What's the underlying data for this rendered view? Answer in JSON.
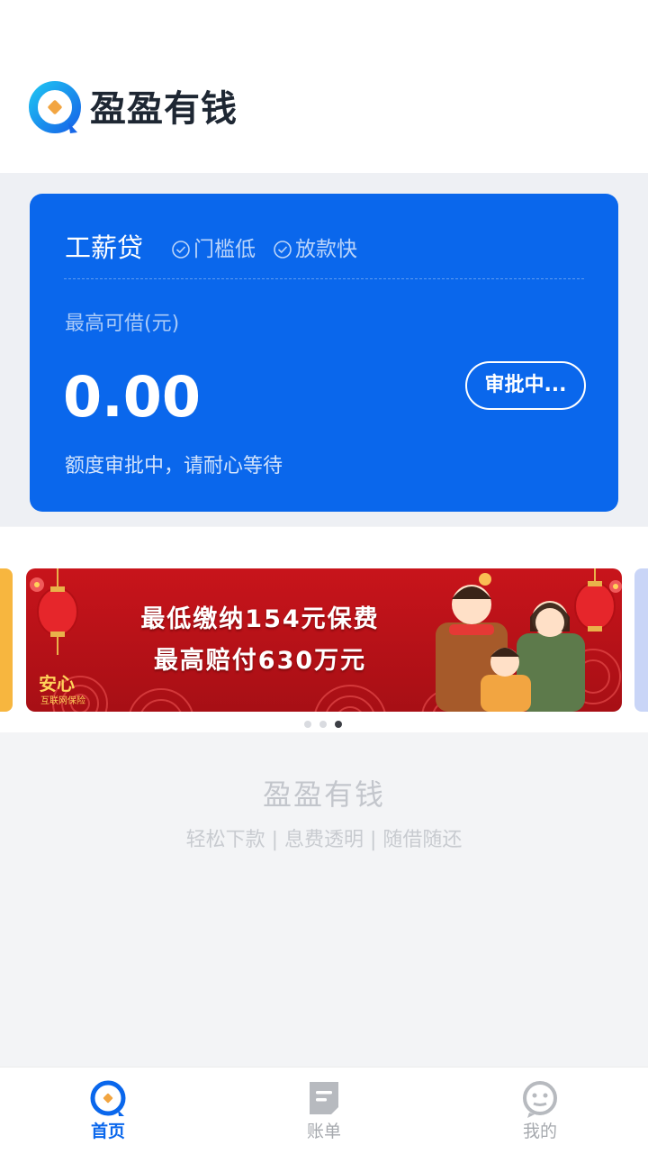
{
  "header": {
    "app_name": "盈盈有钱",
    "logo_icon": "brand-logo-icon"
  },
  "loan_card": {
    "product_name": "工薪贷",
    "tags": [
      "门槛低",
      "放款快"
    ],
    "max_label": "最高可借(元)",
    "amount": "0.00",
    "status_button": "审批中...",
    "hint": "额度审批中，请耐心等待",
    "bg_color": "#0a67ec"
  },
  "banner": {
    "line1": "最低缴纳154元保费",
    "line2": "最高赔付630万元",
    "brand": "安心",
    "brand_sub": "互联网保险",
    "slide_count": 3,
    "active_slide": 3,
    "bg_color": "#c4151c"
  },
  "footer": {
    "brand": "盈盈有钱",
    "slogan": "轻松下款 | 息费透明 | 随借随还"
  },
  "tabbar": {
    "items": [
      {
        "label": "首页",
        "icon": "home-icon",
        "active": true
      },
      {
        "label": "账单",
        "icon": "bill-icon",
        "active": false
      },
      {
        "label": "我的",
        "icon": "profile-icon",
        "active": false
      }
    ],
    "active_color": "#0a67ec"
  }
}
